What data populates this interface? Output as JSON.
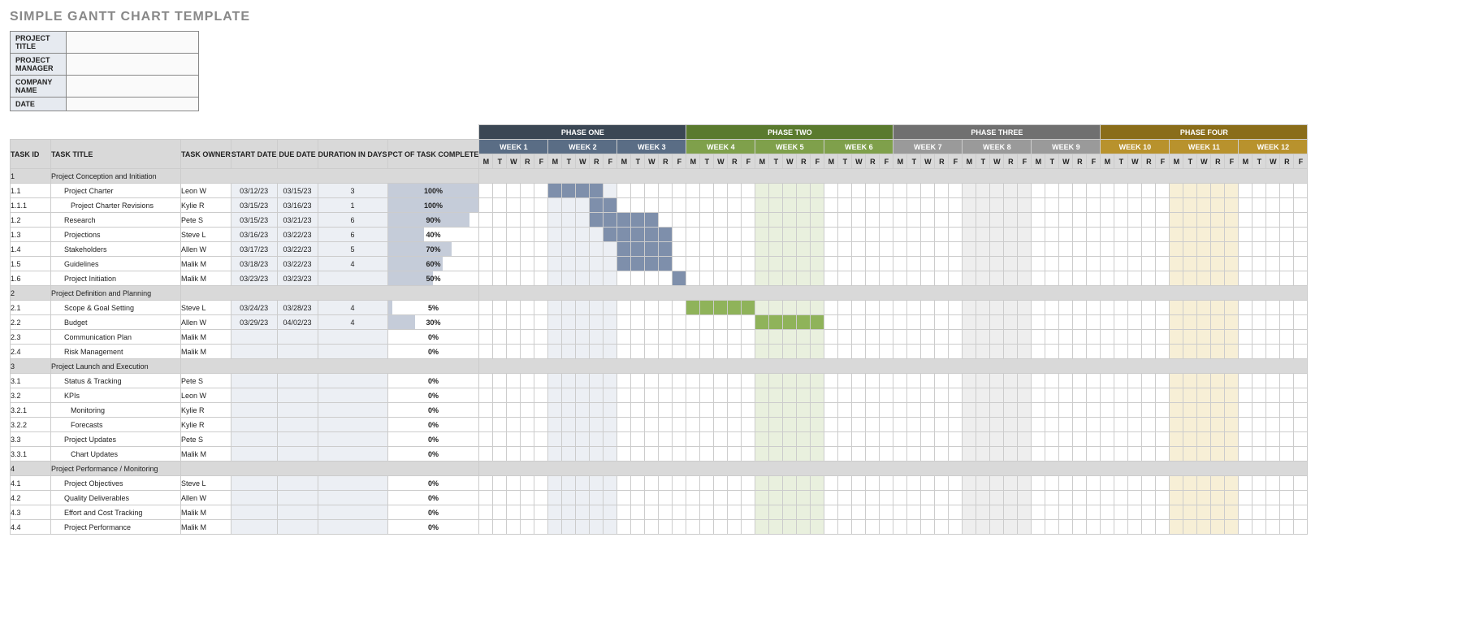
{
  "title": "SIMPLE GANTT CHART TEMPLATE",
  "meta_labels": {
    "project_title": "PROJECT TITLE",
    "project_manager": "PROJECT MANAGER",
    "company_name": "COMPANY NAME",
    "date": "DATE"
  },
  "meta_values": {
    "project_title": "",
    "project_manager": "",
    "company_name": "",
    "date": ""
  },
  "columns": {
    "task_id": "TASK ID",
    "task_title": "TASK TITLE",
    "task_owner": "TASK OWNER",
    "start_date": "START DATE",
    "due_date": "DUE DATE",
    "duration": "DURATION IN DAYS",
    "pct": "PCT OF TASK COMPLETE"
  },
  "phases": [
    {
      "name": "PHASE ONE",
      "bg": "#3b4754",
      "weekbg": "#5a6d85",
      "weeks": [
        "WEEK 1",
        "WEEK 2",
        "WEEK 3"
      ],
      "stripeA": "#eceff4",
      "stripeB": "#ffffff",
      "bar": "#7e8fab"
    },
    {
      "name": "PHASE TWO",
      "bg": "#5a7a2e",
      "weekbg": "#7fa04b",
      "weeks": [
        "WEEK 4",
        "WEEK 5",
        "WEEK 6"
      ],
      "stripeA": "#e9f0de",
      "stripeB": "#ffffff",
      "bar": "#8fb35a"
    },
    {
      "name": "PHASE THREE",
      "bg": "#707070",
      "weekbg": "#9a9a9a",
      "weeks": [
        "WEEK 7",
        "WEEK 8",
        "WEEK 9"
      ],
      "stripeA": "#eeeeee",
      "stripeB": "#ffffff",
      "bar": "#a0a0a0"
    },
    {
      "name": "PHASE FOUR",
      "bg": "#8a6d1a",
      "weekbg": "#b8922d",
      "weeks": [
        "WEEK 10",
        "WEEK 11",
        "WEEK 12"
      ],
      "stripeA": "#f7efd6",
      "stripeB": "#ffffff",
      "bar": "#d0ae4d"
    }
  ],
  "dow": [
    "M",
    "T",
    "W",
    "R",
    "F"
  ],
  "chart_data": {
    "type": "gantt",
    "days_per_week": 5,
    "total_days": 60,
    "rows": [
      {
        "type": "section",
        "id": "1",
        "title": "Project Conception and Initiation"
      },
      {
        "type": "task",
        "id": "1.1",
        "indent": 1,
        "title": "Project Charter",
        "owner": "Leon W",
        "start": "03/12/23",
        "due": "03/15/23",
        "duration": "3",
        "pct": "100%",
        "bar_start": 5,
        "bar_len": 4
      },
      {
        "type": "task",
        "id": "1.1.1",
        "indent": 2,
        "title": "Project Charter Revisions",
        "owner": "Kylie R",
        "start": "03/15/23",
        "due": "03/16/23",
        "duration": "1",
        "pct": "100%",
        "bar_start": 8,
        "bar_len": 2
      },
      {
        "type": "task",
        "id": "1.2",
        "indent": 1,
        "title": "Research",
        "owner": "Pete S",
        "start": "03/15/23",
        "due": "03/21/23",
        "duration": "6",
        "pct": "90%",
        "bar_start": 8,
        "bar_len": 5
      },
      {
        "type": "task",
        "id": "1.3",
        "indent": 1,
        "title": "Projections",
        "owner": "Steve L",
        "start": "03/16/23",
        "due": "03/22/23",
        "duration": "6",
        "pct": "40%",
        "bar_start": 9,
        "bar_len": 5
      },
      {
        "type": "task",
        "id": "1.4",
        "indent": 1,
        "title": "Stakeholders",
        "owner": "Allen W",
        "start": "03/17/23",
        "due": "03/22/23",
        "duration": "5",
        "pct": "70%",
        "bar_start": 10,
        "bar_len": 4
      },
      {
        "type": "task",
        "id": "1.5",
        "indent": 1,
        "title": "Guidelines",
        "owner": "Malik M",
        "start": "03/18/23",
        "due": "03/22/23",
        "duration": "4",
        "pct": "60%",
        "bar_start": 10,
        "bar_len": 4
      },
      {
        "type": "task",
        "id": "1.6",
        "indent": 1,
        "title": "Project Initiation",
        "owner": "Malik M",
        "start": "03/23/23",
        "due": "03/23/23",
        "duration": "",
        "pct": "50%",
        "bar_start": 14,
        "bar_len": 1
      },
      {
        "type": "section",
        "id": "2",
        "title": "Project Definition and Planning"
      },
      {
        "type": "task",
        "id": "2.1",
        "indent": 1,
        "title": "Scope & Goal Setting",
        "owner": "Steve L",
        "start": "03/24/23",
        "due": "03/28/23",
        "duration": "4",
        "pct": "5%",
        "bar_start": 15,
        "bar_len": 5
      },
      {
        "type": "task",
        "id": "2.2",
        "indent": 1,
        "title": "Budget",
        "owner": "Allen W",
        "start": "03/29/23",
        "due": "04/02/23",
        "duration": "4",
        "pct": "30%",
        "bar_start": 20,
        "bar_len": 5
      },
      {
        "type": "task",
        "id": "2.3",
        "indent": 1,
        "title": "Communication Plan",
        "owner": "Malik M",
        "start": "",
        "due": "",
        "duration": "",
        "pct": "0%"
      },
      {
        "type": "task",
        "id": "2.4",
        "indent": 1,
        "title": "Risk Management",
        "owner": "Malik M",
        "start": "",
        "due": "",
        "duration": "",
        "pct": "0%"
      },
      {
        "type": "section",
        "id": "3",
        "title": "Project Launch and Execution"
      },
      {
        "type": "task",
        "id": "3.1",
        "indent": 1,
        "title": "Status & Tracking",
        "owner": "Pete S",
        "start": "",
        "due": "",
        "duration": "",
        "pct": "0%"
      },
      {
        "type": "task",
        "id": "3.2",
        "indent": 1,
        "title": "KPIs",
        "owner": "Leon W",
        "start": "",
        "due": "",
        "duration": "",
        "pct": "0%"
      },
      {
        "type": "task",
        "id": "3.2.1",
        "indent": 2,
        "title": "Monitoring",
        "owner": "Kylie R",
        "start": "",
        "due": "",
        "duration": "",
        "pct": "0%"
      },
      {
        "type": "task",
        "id": "3.2.2",
        "indent": 2,
        "title": "Forecasts",
        "owner": "Kylie R",
        "start": "",
        "due": "",
        "duration": "",
        "pct": "0%"
      },
      {
        "type": "task",
        "id": "3.3",
        "indent": 1,
        "title": "Project Updates",
        "owner": "Pete S",
        "start": "",
        "due": "",
        "duration": "",
        "pct": "0%"
      },
      {
        "type": "task",
        "id": "3.3.1",
        "indent": 2,
        "title": "Chart Updates",
        "owner": "Malik M",
        "start": "",
        "due": "",
        "duration": "",
        "pct": "0%"
      },
      {
        "type": "section",
        "id": "4",
        "title": "Project Performance / Monitoring"
      },
      {
        "type": "task",
        "id": "4.1",
        "indent": 1,
        "title": "Project Objectives",
        "owner": "Steve L",
        "start": "",
        "due": "",
        "duration": "",
        "pct": "0%"
      },
      {
        "type": "task",
        "id": "4.2",
        "indent": 1,
        "title": "Quality Deliverables",
        "owner": "Allen W",
        "start": "",
        "due": "",
        "duration": "",
        "pct": "0%"
      },
      {
        "type": "task",
        "id": "4.3",
        "indent": 1,
        "title": "Effort and Cost Tracking",
        "owner": "Malik M",
        "start": "",
        "due": "",
        "duration": "",
        "pct": "0%"
      },
      {
        "type": "task",
        "id": "4.4",
        "indent": 1,
        "title": "Project Performance",
        "owner": "Malik M",
        "start": "",
        "due": "",
        "duration": "",
        "pct": "0%"
      }
    ]
  }
}
